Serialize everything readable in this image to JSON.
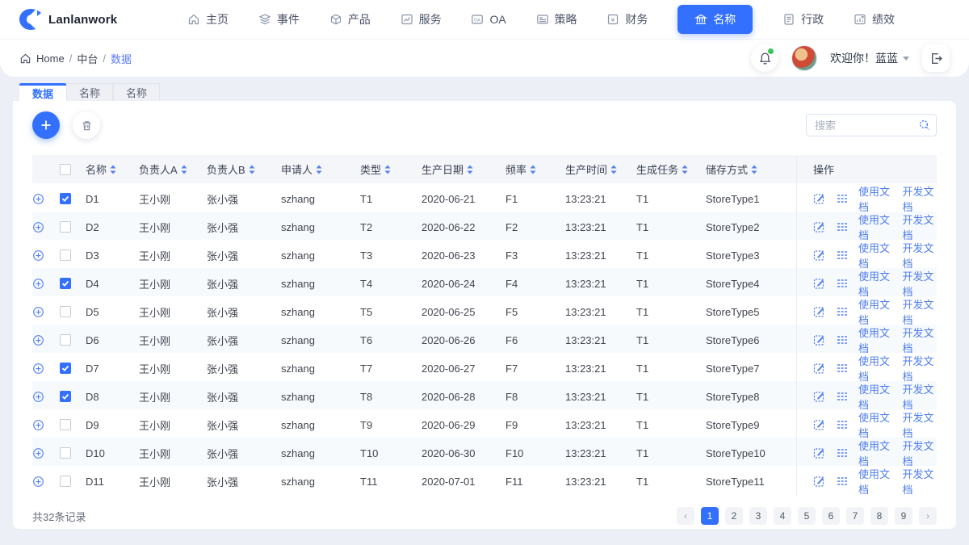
{
  "brand": {
    "name": "Lanlanwork"
  },
  "nav": {
    "items": [
      {
        "key": "home",
        "label": "主页",
        "icon": "home",
        "active": false
      },
      {
        "key": "events",
        "label": "事件",
        "icon": "layers",
        "active": false
      },
      {
        "key": "products",
        "label": "产品",
        "icon": "box",
        "active": false
      },
      {
        "key": "services",
        "label": "服务",
        "icon": "chart",
        "active": false
      },
      {
        "key": "oa",
        "label": "OA",
        "icon": "oa",
        "active": false
      },
      {
        "key": "strategy",
        "label": "策略",
        "icon": "card",
        "active": false
      },
      {
        "key": "finance",
        "label": "财务",
        "icon": "yen",
        "active": false
      },
      {
        "key": "name",
        "label": "名称",
        "icon": "bank",
        "active": true
      },
      {
        "key": "admin",
        "label": "行政",
        "icon": "doc",
        "active": false
      },
      {
        "key": "performance",
        "label": "绩效",
        "icon": "perf",
        "active": false
      }
    ]
  },
  "breadcrumb": {
    "home": "Home",
    "section": "中台",
    "current": "数据",
    "sep1": "/",
    "sep2": "/"
  },
  "user": {
    "welcome": "欢迎你！蓝蓝"
  },
  "tabs": [
    {
      "label": "数据",
      "active": true
    },
    {
      "label": "名称",
      "active": false
    },
    {
      "label": "名称",
      "active": false
    }
  ],
  "toolbar": {
    "search_placeholder": "搜索"
  },
  "table": {
    "columns": [
      {
        "label": "名称",
        "sortable": true
      },
      {
        "label": "负责人A",
        "sortable": true
      },
      {
        "label": "负责人B",
        "sortable": true
      },
      {
        "label": "申请人",
        "sortable": true
      },
      {
        "label": "类型",
        "sortable": true
      },
      {
        "label": "生产日期",
        "sortable": true
      },
      {
        "label": "频率",
        "sortable": true
      },
      {
        "label": "生产时间",
        "sortable": true
      },
      {
        "label": "生成任务",
        "sortable": true
      },
      {
        "label": "储存方式",
        "sortable": true
      }
    ],
    "actions_label": "操作",
    "action_links": [
      "使用文档",
      "开发文档"
    ],
    "rows": [
      {
        "checked": true,
        "name": "D1",
        "ownerA": "王小刚",
        "ownerB": "张小强",
        "applicant": "szhang",
        "type": "T1",
        "date": "2020-06-21",
        "freq": "F1",
        "time": "13:23:21",
        "task": "T1",
        "store": "StoreType1"
      },
      {
        "checked": false,
        "name": "D2",
        "ownerA": "王小刚",
        "ownerB": "张小强",
        "applicant": "szhang",
        "type": "T2",
        "date": "2020-06-22",
        "freq": "F2",
        "time": "13:23:21",
        "task": "T1",
        "store": "StoreType2"
      },
      {
        "checked": false,
        "name": "D3",
        "ownerA": "王小刚",
        "ownerB": "张小强",
        "applicant": "szhang",
        "type": "T3",
        "date": "2020-06-23",
        "freq": "F3",
        "time": "13:23:21",
        "task": "T1",
        "store": "StoreType3"
      },
      {
        "checked": true,
        "name": "D4",
        "ownerA": "王小刚",
        "ownerB": "张小强",
        "applicant": "szhang",
        "type": "T4",
        "date": "2020-06-24",
        "freq": "F4",
        "time": "13:23:21",
        "task": "T1",
        "store": "StoreType4"
      },
      {
        "checked": false,
        "name": "D5",
        "ownerA": "王小刚",
        "ownerB": "张小强",
        "applicant": "szhang",
        "type": "T5",
        "date": "2020-06-25",
        "freq": "F5",
        "time": "13:23:21",
        "task": "T1",
        "store": "StoreType5"
      },
      {
        "checked": false,
        "name": "D6",
        "ownerA": "王小刚",
        "ownerB": "张小强",
        "applicant": "szhang",
        "type": "T6",
        "date": "2020-06-26",
        "freq": "F6",
        "time": "13:23:21",
        "task": "T1",
        "store": "StoreType6"
      },
      {
        "checked": true,
        "name": "D7",
        "ownerA": "王小刚",
        "ownerB": "张小强",
        "applicant": "szhang",
        "type": "T7",
        "date": "2020-06-27",
        "freq": "F7",
        "time": "13:23:21",
        "task": "T1",
        "store": "StoreType7"
      },
      {
        "checked": true,
        "name": "D8",
        "ownerA": "王小刚",
        "ownerB": "张小强",
        "applicant": "szhang",
        "type": "T8",
        "date": "2020-06-28",
        "freq": "F8",
        "time": "13:23:21",
        "task": "T1",
        "store": "StoreType8"
      },
      {
        "checked": false,
        "name": "D9",
        "ownerA": "王小刚",
        "ownerB": "张小强",
        "applicant": "szhang",
        "type": "T9",
        "date": "2020-06-29",
        "freq": "F9",
        "time": "13:23:21",
        "task": "T1",
        "store": "StoreType9"
      },
      {
        "checked": false,
        "name": "D10",
        "ownerA": "王小刚",
        "ownerB": "张小强",
        "applicant": "szhang",
        "type": "T10",
        "date": "2020-06-30",
        "freq": "F10",
        "time": "13:23:21",
        "task": "T1",
        "store": "StoreType10"
      },
      {
        "checked": false,
        "name": "D11",
        "ownerA": "王小刚",
        "ownerB": "张小强",
        "applicant": "szhang",
        "type": "T11",
        "date": "2020-07-01",
        "freq": "F11",
        "time": "13:23:21",
        "task": "T1",
        "store": "StoreType11"
      }
    ]
  },
  "footer": {
    "total": "共32条记录",
    "pages": [
      "1",
      "2",
      "3",
      "4",
      "5",
      "6",
      "7",
      "8",
      "9"
    ],
    "active_page": "1",
    "prev": "‹",
    "next": "›"
  },
  "colors": {
    "primary": "#3370ff",
    "link": "#4e7cf0",
    "stripe": "#f7fafd",
    "page_bg": "#edeff7",
    "online_dot": "#35c759"
  }
}
